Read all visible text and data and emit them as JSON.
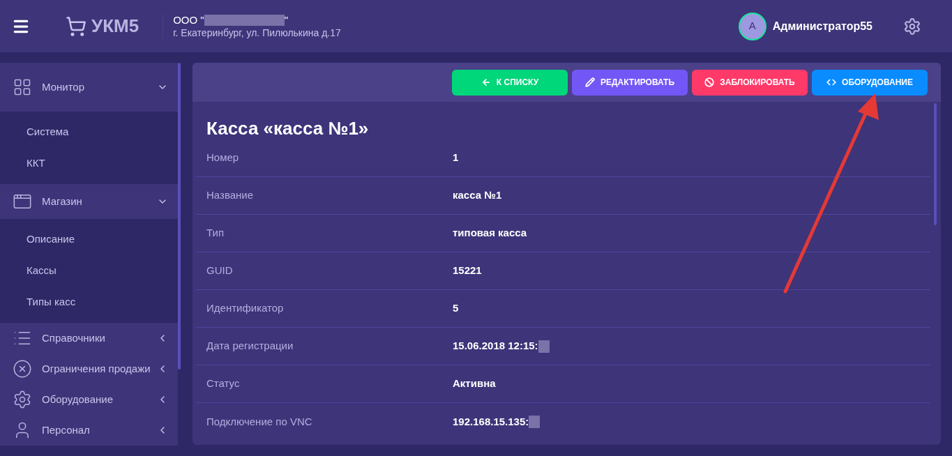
{
  "header": {
    "logo_text": "УКМ5",
    "org_prefix": "ООО \"",
    "org_redacted": true,
    "org_suffix": "\"",
    "address": "г. Екатеринбург, ул. Пилюлькина д.17",
    "avatar_letter": "А",
    "user_name": "Администратор55"
  },
  "sidebar": {
    "items": [
      {
        "label": "Монитор",
        "kind": "grid",
        "expanded": true,
        "children": [
          {
            "label": "Система"
          },
          {
            "label": "ККТ"
          }
        ]
      },
      {
        "label": "Магазин",
        "kind": "window",
        "expanded": true,
        "children": [
          {
            "label": "Описание"
          },
          {
            "label": "Кассы"
          },
          {
            "label": "Типы касс"
          }
        ]
      },
      {
        "label": "Справочники",
        "kind": "list",
        "expanded": false
      },
      {
        "label": "Ограничения продажи",
        "kind": "cross",
        "expanded": false
      },
      {
        "label": "Оборудование",
        "kind": "gear",
        "expanded": false
      },
      {
        "label": "Персонал",
        "kind": "person",
        "expanded": false
      }
    ]
  },
  "toolbar": {
    "buttons": [
      {
        "label": "К СПИСКУ",
        "kind": "back"
      },
      {
        "label": "РЕДАКТИРОВАТЬ",
        "kind": "edit"
      },
      {
        "label": "ЗАБЛОКИРОВАТЬ",
        "kind": "block"
      },
      {
        "label": "ОБОРУДОВАНИЕ",
        "kind": "code"
      }
    ]
  },
  "detail": {
    "title": "Касса «касса №1»",
    "rows": [
      {
        "label": "Номер",
        "value": "1",
        "redacted": false
      },
      {
        "label": "Название",
        "value": "касса №1",
        "redacted": false
      },
      {
        "label": "Тип",
        "value": "типовая касса",
        "redacted": false
      },
      {
        "label": "GUID",
        "value": "15221",
        "redacted": false
      },
      {
        "label": "Идентификатор",
        "value": "5",
        "redacted": false
      },
      {
        "label": "Дата регистрации",
        "value": "15.06.2018 12:15:",
        "redacted": true
      },
      {
        "label": "Статус",
        "value": "Активна",
        "redacted": false
      },
      {
        "label": "Подключение по VNC",
        "value": "192.168.15.135:",
        "redacted": true
      }
    ]
  }
}
